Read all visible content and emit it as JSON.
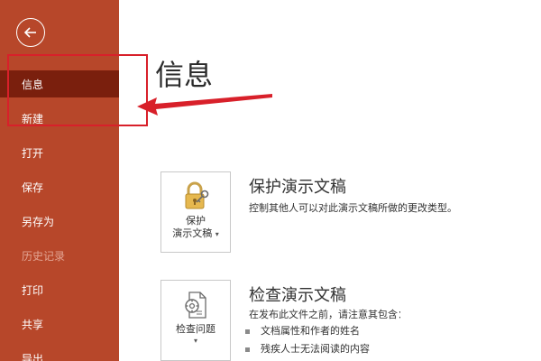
{
  "sidebar": {
    "background_color": "#b7472a",
    "selected_color": "#7a1f0d",
    "back_icon": "back-arrow-icon",
    "items": [
      {
        "label": "信息",
        "state": "selected"
      },
      {
        "label": "新建",
        "state": "normal"
      },
      {
        "label": "打开",
        "state": "normal"
      },
      {
        "label": "保存",
        "state": "normal"
      },
      {
        "label": "另存为",
        "state": "normal"
      },
      {
        "label": "历史记录",
        "state": "disabled"
      },
      {
        "label": "打印",
        "state": "normal"
      },
      {
        "label": "共享",
        "state": "normal"
      },
      {
        "label": "导出",
        "state": "normal"
      }
    ]
  },
  "annotation": {
    "color": "#d8202a"
  },
  "main": {
    "title": "信息",
    "protect": {
      "tile_line1": "保护",
      "tile_line2": "演示文稿",
      "tile_caret": "▾",
      "icon": "lock-key-icon",
      "title": "保护演示文稿",
      "description": "控制其他人可以对此演示文稿所做的更改类型。"
    },
    "inspect": {
      "tile_line1": "检查问题",
      "tile_caret": "▾",
      "icon": "inspect-document-icon",
      "title": "检查演示文稿",
      "description": "在发布此文件之前，请注意其包含：",
      "bullets": [
        "文档属性和作者的姓名",
        "残疾人士无法阅读的内容"
      ]
    }
  }
}
